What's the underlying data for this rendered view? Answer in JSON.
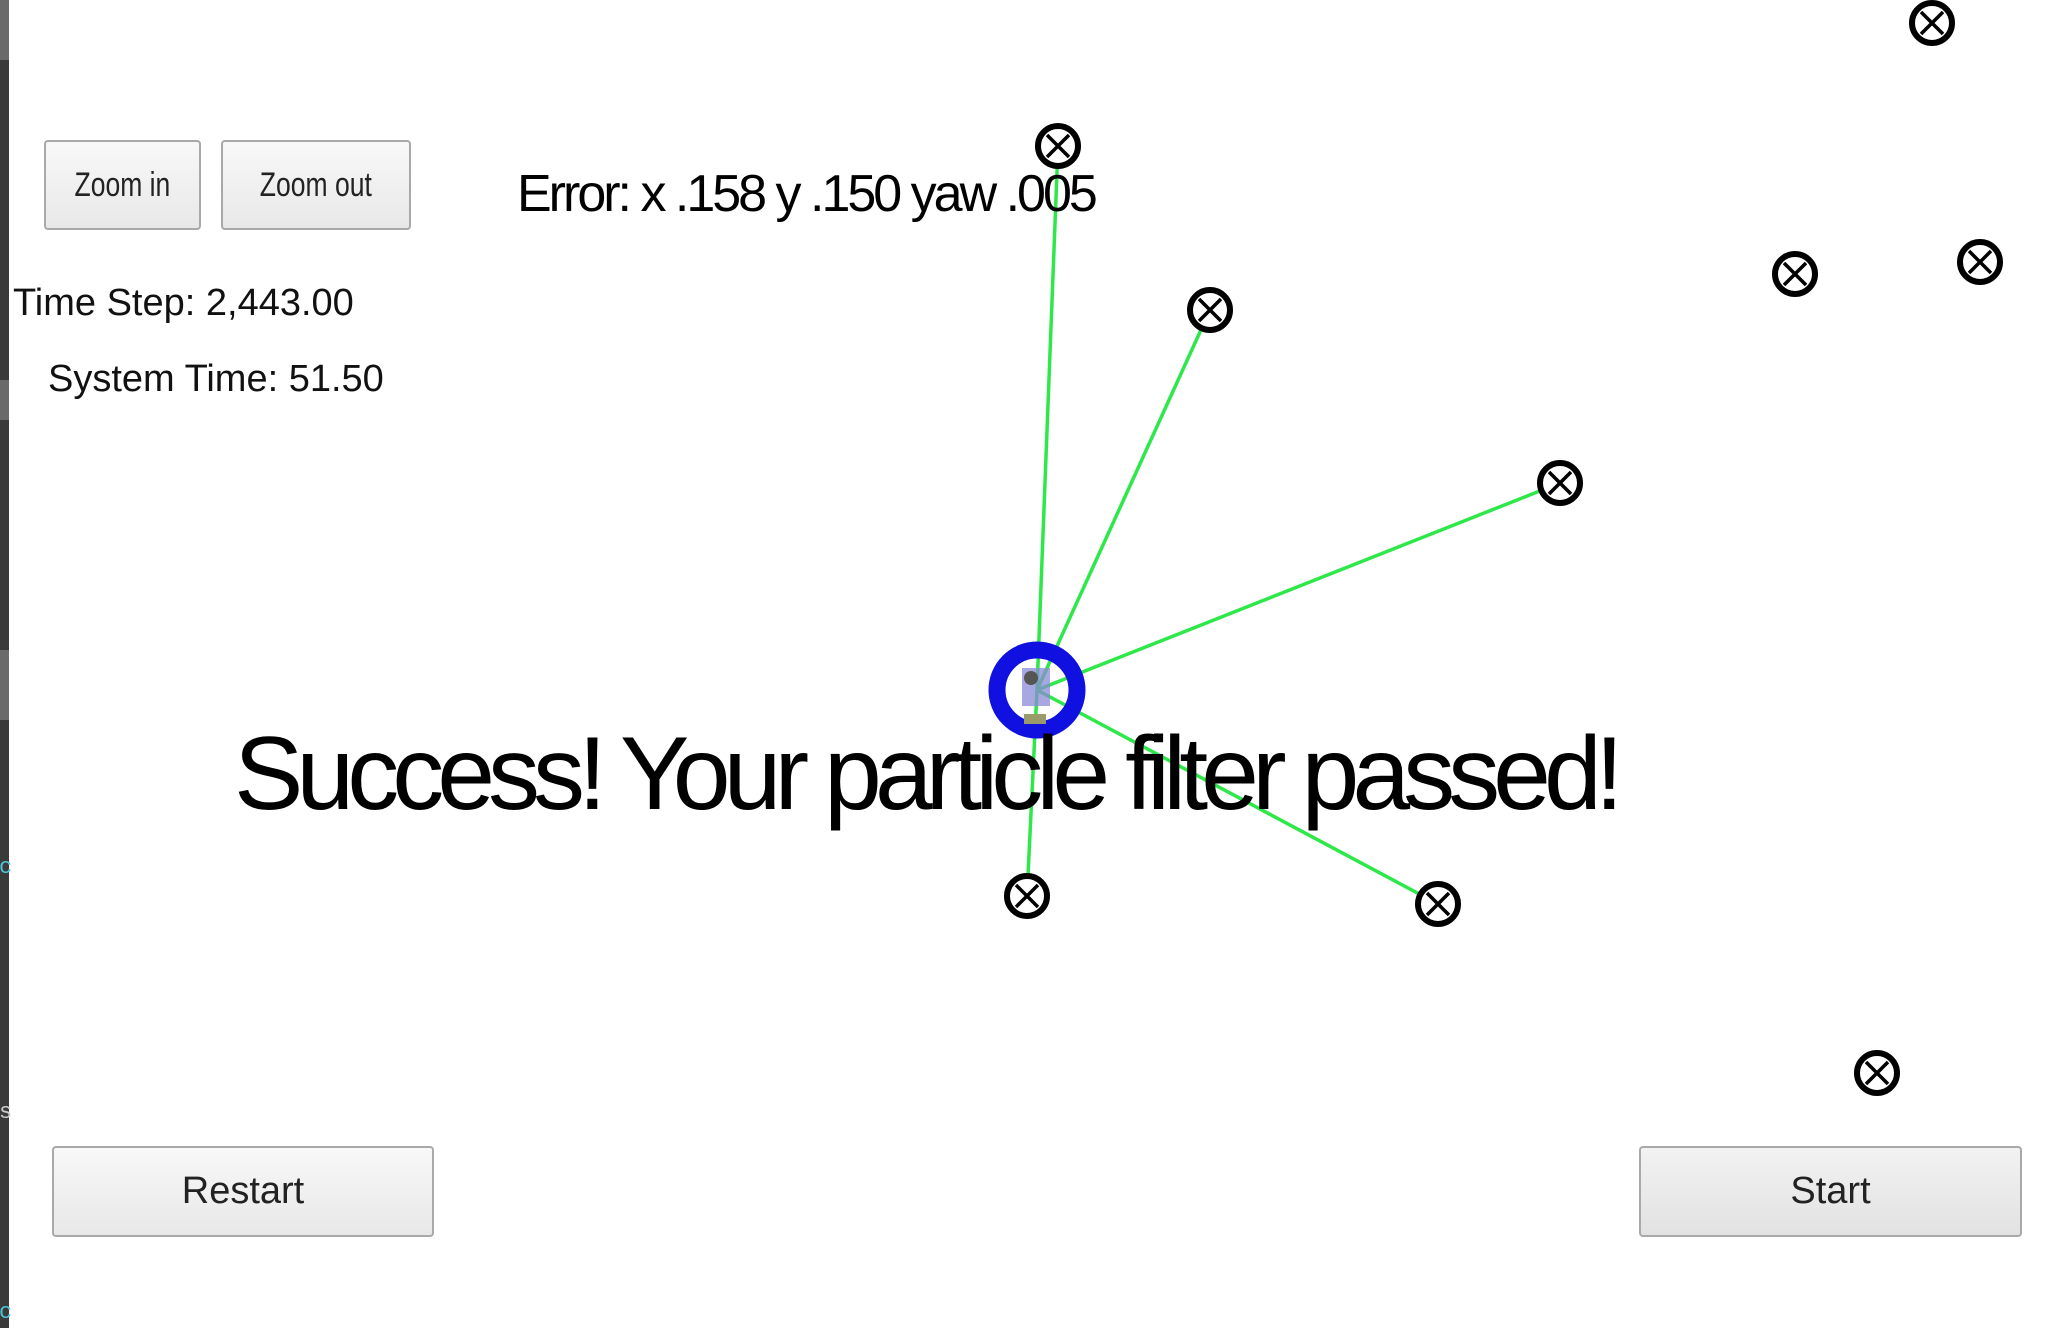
{
  "toolbar": {
    "zoom_in_label": "Zoom in",
    "zoom_out_label": "Zoom out"
  },
  "stats": {
    "time_step": "Time Step: 2,443.00",
    "system_time": "System Time: 51.50"
  },
  "error": {
    "text": "Error: x .158 y .150 yaw .005"
  },
  "status": {
    "message": "Success! Your particle filter passed!"
  },
  "controls": {
    "restart_label": "Restart",
    "start_label": "Start"
  },
  "colors": {
    "observation_line": "#2ee84a",
    "vehicle": "#1010e0",
    "landmark": "#000000"
  },
  "icons": {
    "landmark": "circled-x-icon",
    "vehicle": "vehicle-icon"
  }
}
